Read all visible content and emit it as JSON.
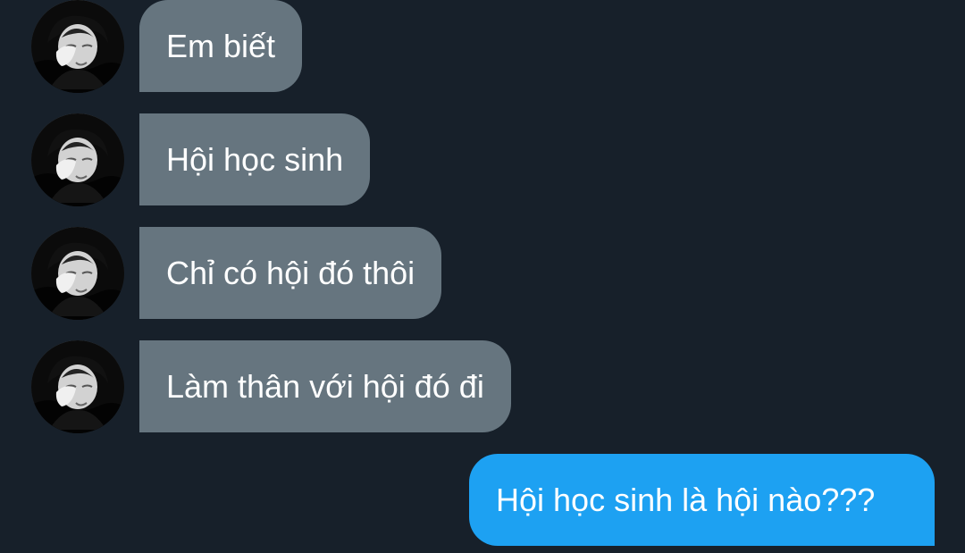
{
  "conversation": {
    "messages": [
      {
        "sender": "other",
        "text": "Em biết"
      },
      {
        "sender": "other",
        "text": "Hội học sinh"
      },
      {
        "sender": "other",
        "text": "Chỉ có hội đó thôi"
      },
      {
        "sender": "other",
        "text": "Làm thân với hội đó đi"
      },
      {
        "sender": "self",
        "text": "Hội học sinh là hội nào???"
      }
    ]
  },
  "colors": {
    "background": "#17202a",
    "received_bubble": "#66757f",
    "sent_bubble": "#1da1f2",
    "text": "#ffffff"
  },
  "icons": [
    "avatar-photo"
  ]
}
